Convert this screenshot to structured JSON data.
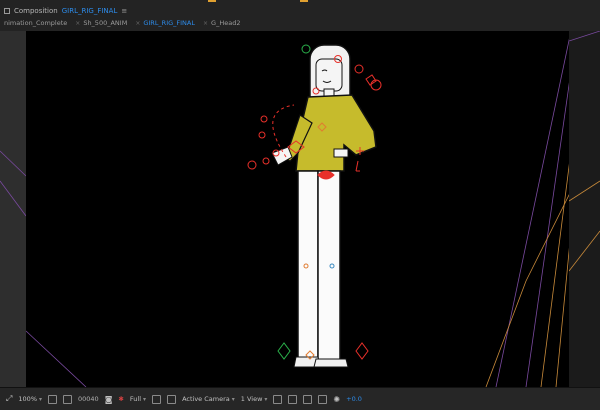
{
  "header": {
    "panel_label": "Composition",
    "comp_name": "GIRL_RIG_FINAL",
    "menu_icon": "hamburger-icon"
  },
  "tabs": [
    {
      "label": "nimation_Complete",
      "active": false
    },
    {
      "label": "Sh_500_ANIM",
      "active": false
    },
    {
      "label": "GIRL_RIG_FINAL",
      "active": true
    },
    {
      "label": "G_Head2",
      "active": false
    }
  ],
  "toolbar": {
    "zoom": "100%",
    "timecode": "00040",
    "resolution": "Full",
    "camera": "Active Camera",
    "views": "1 View",
    "exposure": "+0.0"
  },
  "colors": {
    "accent": "#2d8ceb",
    "shirt": "#c6bb2c",
    "rig_red": "#e8302a",
    "foot_green": "#2ab04a",
    "guide_purple": "#7a4aa0",
    "guide_orange": "#c88a3a"
  }
}
